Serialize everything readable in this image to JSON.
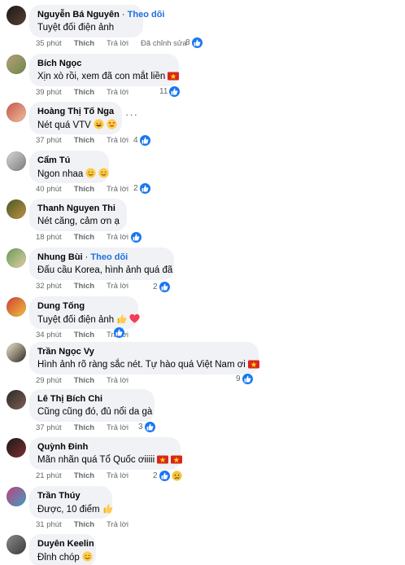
{
  "actions": {
    "like_label": "Thích",
    "reply_label": "Trả lời",
    "edited_label": "Đã chỉnh sửa"
  },
  "colors": {
    "bubble": "#f0f2f5",
    "link_blue": "#216fdb",
    "meta_gray": "#65676b",
    "like_blue": "#1877f2",
    "heart_red": "#f33e58"
  },
  "comments": [
    {
      "author": "Nguyễn Bá Nguyên",
      "follow": "Theo dõi",
      "text": "Tuyệt đối điện ảnh",
      "emojis": [],
      "time": "35 phút",
      "edited": true,
      "reactions": {
        "icons": [
          "like-icon"
        ],
        "count": "8"
      },
      "avatar_colors": [
        "#1a1a1a",
        "#5a4030"
      ]
    },
    {
      "author": "Bích Ngọc",
      "follow": "",
      "text": "Xịn xò rồi, xem đã con mắt liền",
      "emojis": [
        "vietnam-flag-icon"
      ],
      "time": "39 phút",
      "edited": false,
      "reactions": {
        "icons": [
          "like-icon"
        ],
        "count": "11"
      },
      "avatar_colors": [
        "#b89f7a",
        "#6b8a4a"
      ]
    },
    {
      "author": "Hoàng Thị Tố Nga",
      "follow": "",
      "text": "Nét quá VTV",
      "emojis": [
        "grinning-face-icon",
        "heart-eyes-face-icon"
      ],
      "time": "37 phút",
      "edited": false,
      "reactions": {
        "icons": [
          "like-icon"
        ],
        "count": "4"
      },
      "avatar_colors": [
        "#c8564a",
        "#f0c0a0"
      ]
    },
    {
      "author": "Cẩm Tú",
      "follow": "",
      "text": "Ngon nhaa",
      "emojis": [
        "smiling-face-icon",
        "smiling-face-icon"
      ],
      "time": "40 phút",
      "edited": false,
      "reactions": {
        "icons": [
          "like-icon"
        ],
        "count": "2"
      },
      "avatar_colors": [
        "#d8d8d8",
        "#7a7a7a"
      ]
    },
    {
      "author": "Thanh Nguyen Thi",
      "follow": "",
      "text": "Nét căng, cảm ơn ạ",
      "emojis": [],
      "time": "18 phút",
      "edited": false,
      "reactions": {
        "icons": [
          "like-icon"
        ],
        "count": ""
      },
      "avatar_colors": [
        "#4a5a2a",
        "#c09040"
      ]
    },
    {
      "author": "Nhung Bùi",
      "follow": "Theo dõi",
      "text": "Đấu cầu Korea, hình ảnh quá đã",
      "emojis": [],
      "time": "32 phút",
      "edited": false,
      "reactions": {
        "icons": [
          "like-icon"
        ],
        "count": "2"
      },
      "avatar_colors": [
        "#6a9a5a",
        "#e0d0a0"
      ]
    },
    {
      "author": "Dung Tống",
      "follow": "",
      "text": "Tuyệt đối điện ảnh",
      "emojis": [
        "thumbs-up-emoji-icon",
        "red-heart-icon"
      ],
      "time": "34 phút",
      "edited": false,
      "reactions": {
        "icons": [
          "like-icon"
        ],
        "count": ""
      },
      "avatar_colors": [
        "#d04030",
        "#f0c040"
      ]
    },
    {
      "author": "Trần Ngọc Vy",
      "follow": "",
      "text": "Hình ảnh rõ ràng sắc nét. Tự hào quá Việt Nam ơi",
      "emojis": [
        "vietnam-flag-icon"
      ],
      "time": "29 phút",
      "edited": false,
      "reactions": {
        "icons": [
          "like-icon"
        ],
        "count": "9"
      },
      "avatar_colors": [
        "#f0e8d0",
        "#302820"
      ]
    },
    {
      "author": "Lê Thị Bích Chi",
      "follow": "",
      "text": "Cũng cũng đó, đủ nổi da gà",
      "emojis": [],
      "time": "37 phút",
      "edited": false,
      "reactions": {
        "icons": [
          "like-icon"
        ],
        "count": "3"
      },
      "avatar_colors": [
        "#2a2a2a",
        "#806050"
      ]
    },
    {
      "author": "Quỳnh Đinh",
      "follow": "",
      "text": "Mãn nhãn quá Tổ Quốc ơiiiii",
      "emojis": [
        "vietnam-flag-icon",
        "vietnam-flag-icon"
      ],
      "time": "21 phút",
      "edited": false,
      "reactions": {
        "icons": [
          "like-icon",
          "sad-face-icon"
        ],
        "count": "2"
      },
      "avatar_colors": [
        "#1a1a1a",
        "#803030"
      ]
    },
    {
      "author": "Trần Thúy",
      "follow": "",
      "text": "Được, 10 điểm",
      "emojis": [
        "thumbs-up-emoji-icon"
      ],
      "time": "31 phút",
      "edited": false,
      "reactions": {
        "icons": [],
        "count": ""
      },
      "avatar_colors": [
        "#c04080",
        "#40a0c0"
      ]
    },
    {
      "author": "Duyên Keelin",
      "follow": "",
      "text": "Đỉnh chóp",
      "emojis": [
        "smiling-face-icon"
      ],
      "time": "",
      "edited": false,
      "reactions": {
        "icons": [],
        "count": ""
      },
      "avatar_colors": [
        "#8a8a8a",
        "#3a3a3a"
      ]
    }
  ]
}
